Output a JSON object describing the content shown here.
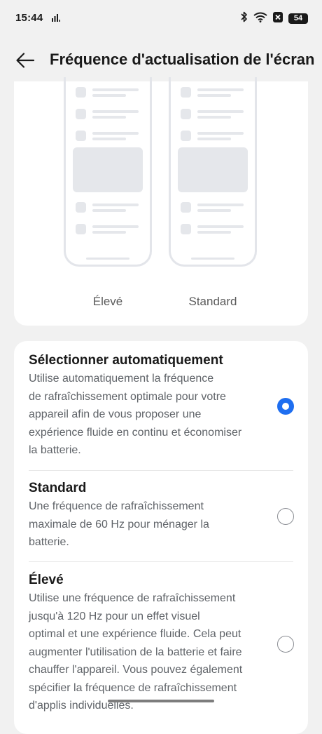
{
  "status_bar": {
    "time": "15:44",
    "battery": "54",
    "icons": [
      "signal-bars-icon",
      "bluetooth-icon",
      "wifi-icon",
      "sim-x-icon",
      "battery-icon"
    ]
  },
  "header": {
    "back_icon": "arrow-left-icon",
    "title": "Fréquence d'actualisation de l'écran"
  },
  "preview": {
    "labels": [
      "Élevé",
      "Standard"
    ]
  },
  "options": [
    {
      "title": "Sélectionner automatiquement",
      "description_lines": [
        "Utilise automatiquement la fréquence",
        "de rafraîchissement optimale pour votre",
        "appareil afin de vous proposer une",
        "expérience fluide en continu et économiser",
        "la batterie."
      ],
      "selected": true
    },
    {
      "title": "Standard",
      "description_lines": [
        "Une fréquence de rafraîchissement",
        "maximale de 60 Hz pour ménager la",
        "batterie."
      ],
      "selected": false
    },
    {
      "title": "Élevé",
      "description_lines": [
        "Utilise une fréquence de rafraîchissement",
        "jusqu'à 120 Hz pour un effet visuel",
        "optimal et une expérience fluide. Cela peut",
        "augmenter l'utilisation de la batterie et faire",
        "chauffer l'appareil. Vous pouvez également",
        "spécifier la fréquence de rafraîchissement",
        "d'applis individuelles."
      ],
      "selected": false
    }
  ],
  "colors": {
    "accent": "#1e6ef0",
    "background": "#f1f1f1",
    "card": "#ffffff",
    "preview_outline": "#e3e5ea"
  }
}
